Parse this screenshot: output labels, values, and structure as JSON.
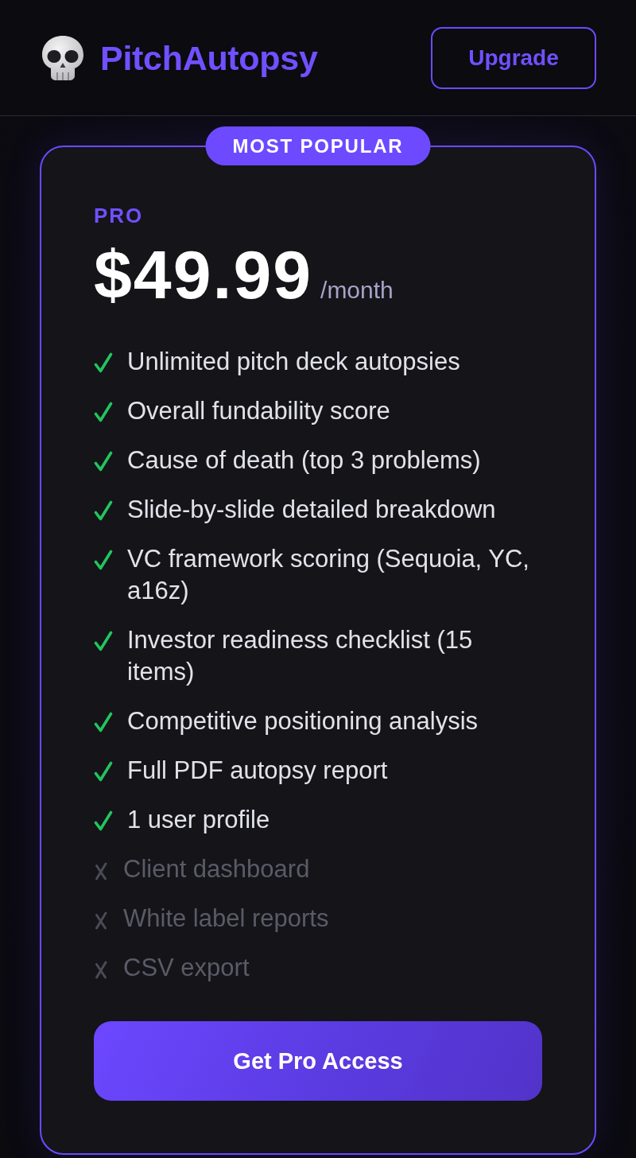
{
  "header": {
    "logo_text": "PitchAutopsy",
    "upgrade_button": "Upgrade"
  },
  "plan_card": {
    "badge": "MOST POPULAR",
    "plan_name": "PRO",
    "price": "$49.99",
    "period": "/month",
    "features": [
      {
        "text": "Unlimited pitch deck autopsies",
        "included": true
      },
      {
        "text": "Overall fundability score",
        "included": true
      },
      {
        "text": "Cause of death (top 3 problems)",
        "included": true
      },
      {
        "text": "Slide-by-slide detailed breakdown",
        "included": true
      },
      {
        "text": "VC framework scoring (Sequoia, YC, a16z)",
        "included": true
      },
      {
        "text": "Investor readiness checklist (15 items)",
        "included": true
      },
      {
        "text": "Competitive positioning analysis",
        "included": true
      },
      {
        "text": "Full PDF autopsy report",
        "included": true
      },
      {
        "text": "1 user profile",
        "included": true
      },
      {
        "text": "Client dashboard",
        "included": false
      },
      {
        "text": "White label reports",
        "included": false
      },
      {
        "text": "CSV export",
        "included": false
      }
    ],
    "cta_button": "Get Pro Access"
  }
}
